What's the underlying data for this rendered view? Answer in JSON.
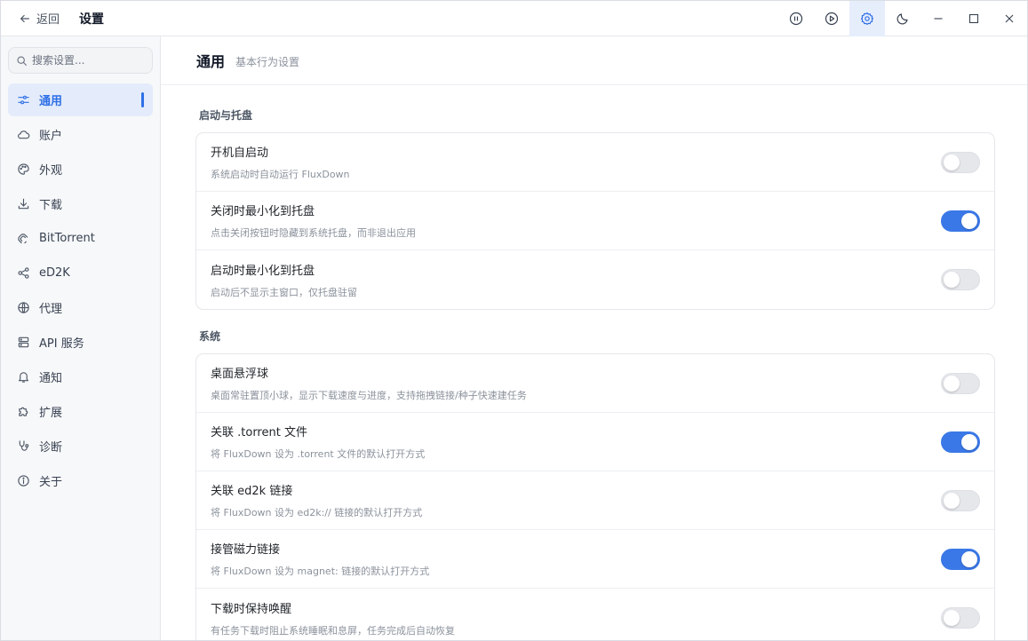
{
  "titlebar": {
    "back_label": "返回",
    "title": "设置",
    "buttons": [
      {
        "icon": "pause-circle-icon",
        "active": false
      },
      {
        "icon": "play-circle-icon",
        "active": false
      },
      {
        "icon": "gear-icon",
        "active": true
      },
      {
        "icon": "moon-icon",
        "active": false
      },
      {
        "icon": "minimize-icon",
        "active": false
      },
      {
        "icon": "maximize-icon",
        "active": false
      },
      {
        "icon": "close-icon",
        "active": false
      }
    ]
  },
  "sidebar": {
    "search_placeholder": "搜索设置...",
    "items": [
      {
        "label": "通用",
        "icon": "sliders-icon",
        "active": true
      },
      {
        "label": "账户",
        "icon": "cloud-icon",
        "active": false
      },
      {
        "label": "外观",
        "icon": "palette-icon",
        "active": false
      },
      {
        "label": "下载",
        "icon": "download-icon",
        "active": false
      },
      {
        "label": "BitTorrent",
        "icon": "bittorrent-icon",
        "active": false
      },
      {
        "label": "eD2K",
        "icon": "share-icon",
        "active": false
      },
      {
        "label": "代理",
        "icon": "globe-icon",
        "active": false
      },
      {
        "label": "API 服务",
        "icon": "server-icon",
        "active": false
      },
      {
        "label": "通知",
        "icon": "bell-icon",
        "active": false
      },
      {
        "label": "扩展",
        "icon": "puzzle-icon",
        "active": false
      },
      {
        "label": "诊断",
        "icon": "stethoscope-icon",
        "active": false
      },
      {
        "label": "关于",
        "icon": "info-icon",
        "active": false
      }
    ]
  },
  "main": {
    "title": "通用",
    "subtitle": "基本行为设置",
    "sections": [
      {
        "title": "启动与托盘",
        "rows": [
          {
            "title": "开机自启动",
            "desc": "系统启动时自动运行 FluxDown",
            "on": false
          },
          {
            "title": "关闭时最小化到托盘",
            "desc": "点击关闭按钮时隐藏到系统托盘，而非退出应用",
            "on": true
          },
          {
            "title": "启动时最小化到托盘",
            "desc": "启动后不显示主窗口，仅托盘驻留",
            "on": false
          }
        ]
      },
      {
        "title": "系统",
        "rows": [
          {
            "title": "桌面悬浮球",
            "desc": "桌面常驻置顶小球，显示下载速度与进度，支持拖拽链接/种子快速建任务",
            "on": false
          },
          {
            "title": "关联 .torrent 文件",
            "desc": "将 FluxDown 设为 .torrent 文件的默认打开方式",
            "on": true
          },
          {
            "title": "关联 ed2k 链接",
            "desc": "将 FluxDown 设为 ed2k:// 链接的默认打开方式",
            "on": false
          },
          {
            "title": "接管磁力链接",
            "desc": "将 FluxDown 设为 magnet: 链接的默认打开方式",
            "on": true
          },
          {
            "title": "下载时保持唤醒",
            "desc": "有任务下载时阻止系统睡眠和息屏，任务完成后自动恢复",
            "on": false
          }
        ]
      }
    ]
  },
  "colors": {
    "accent": "#3b78e7",
    "toggle_off": "#e5e7eb",
    "sidebar_bg": "#f7f8fa"
  }
}
